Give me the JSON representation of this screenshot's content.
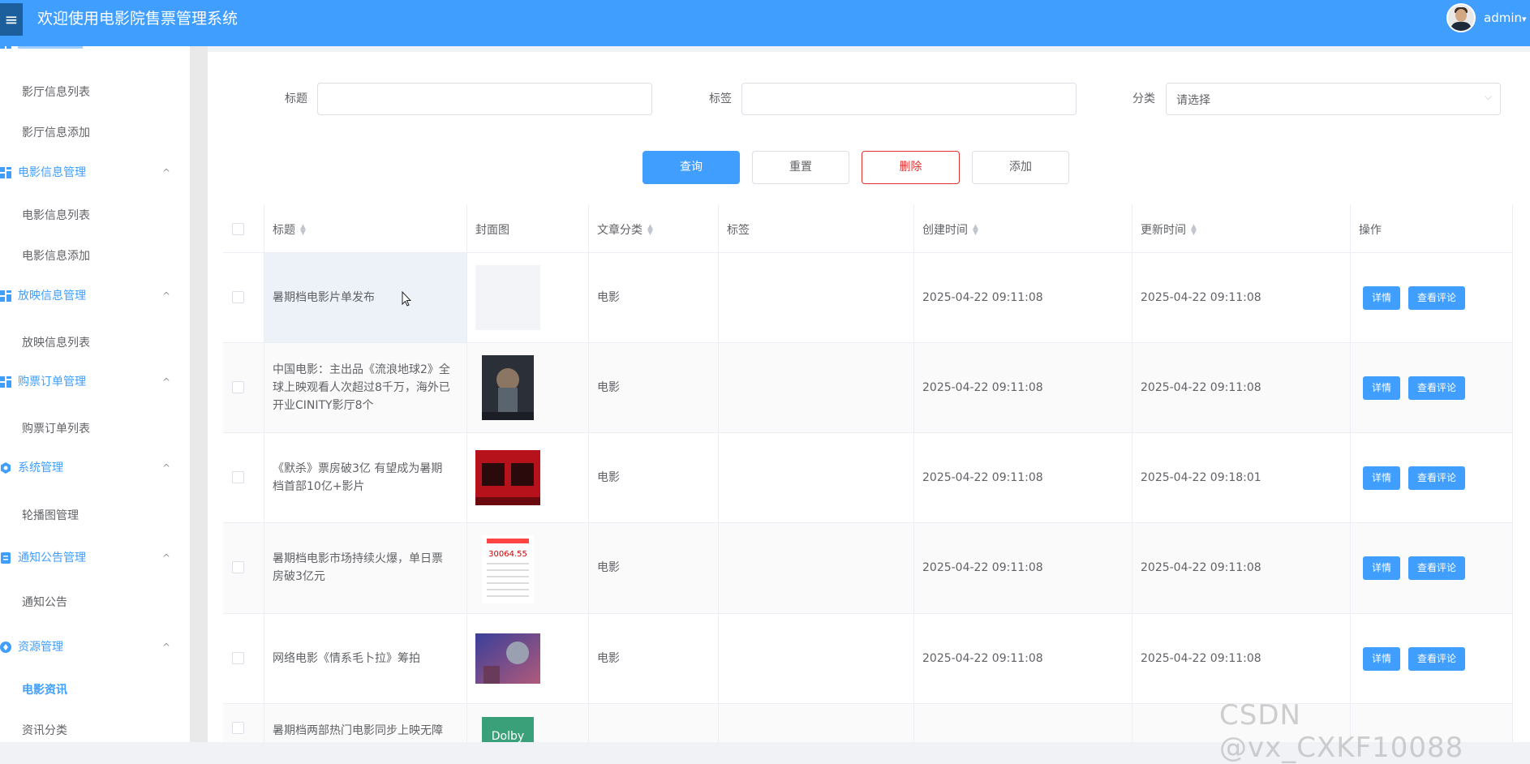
{
  "header": {
    "title": "欢迎使用电影院售票管理系统",
    "username": "admin",
    "dropdown_caret": "▾",
    "menu_toggle_glyph": "≡"
  },
  "sidebar": {
    "items": [
      {
        "type": "item",
        "label": "影厅信息列表"
      },
      {
        "type": "item",
        "label": "影厅信息添加"
      },
      {
        "type": "group",
        "label": "电影信息管理",
        "icon": "grid-icon"
      },
      {
        "type": "item",
        "label": "电影信息列表"
      },
      {
        "type": "item",
        "label": "电影信息添加"
      },
      {
        "type": "group",
        "label": "放映信息管理",
        "icon": "grid-icon"
      },
      {
        "type": "item",
        "label": "放映信息列表"
      },
      {
        "type": "group",
        "label": "购票订单管理",
        "icon": "grid-icon"
      },
      {
        "type": "item",
        "label": "购票订单列表"
      },
      {
        "type": "group",
        "label": "系统管理",
        "icon": "gear-icon"
      },
      {
        "type": "item",
        "label": "轮播图管理"
      },
      {
        "type": "group",
        "label": "通知公告管理",
        "icon": "document-icon"
      },
      {
        "type": "item",
        "label": "通知公告"
      },
      {
        "type": "group",
        "label": "资源管理",
        "icon": "resource-icon"
      },
      {
        "type": "item",
        "label": "电影资讯",
        "active": true
      },
      {
        "type": "item",
        "label": "资讯分类"
      }
    ],
    "chevron": "^"
  },
  "filters": {
    "title_label": "标题",
    "title_value": "",
    "tag_label": "标签",
    "tag_value": "",
    "category_label": "分类",
    "category_placeholder": "请选择"
  },
  "actions": {
    "query": "查询",
    "reset": "重置",
    "delete": "删除",
    "add": "添加"
  },
  "table": {
    "headers": {
      "title": "标题",
      "cover": "封面图",
      "category": "文章分类",
      "tags": "标签",
      "created": "创建时间",
      "updated": "更新时间",
      "ops": "操作"
    },
    "rows": [
      {
        "title": "暑期档电影片单发布",
        "category": "电影",
        "tags": "",
        "created": "2025-04-22 09:11:08",
        "updated": "2025-04-22 09:11:08",
        "cover": "blank"
      },
      {
        "title": "中国电影：主出品《流浪地球2》全球上映观看人次超过8千万，海外已开业CINITY影厅8个",
        "category": "电影",
        "tags": "",
        "created": "2025-04-22 09:11:08",
        "updated": "2025-04-22 09:11:08",
        "cover": "wandering-earth-poster"
      },
      {
        "title": "《默杀》票房破3亿 有望成为暑期档首部10亿+影片",
        "category": "电影",
        "tags": "",
        "created": "2025-04-22 09:11:08",
        "updated": "2025-04-22 09:18:01",
        "cover": "red-poster"
      },
      {
        "title": "暑期档电影市场持续火爆，单日票房破3亿元",
        "category": "电影",
        "tags": "",
        "created": "2025-04-22 09:11:08",
        "updated": "2025-04-22 09:11:08",
        "cover": "box-office-chart",
        "cover_text": "30064.55"
      },
      {
        "title": "网络电影《情系毛卜拉》筹拍",
        "category": "电影",
        "tags": "",
        "created": "2025-04-22 09:11:08",
        "updated": "2025-04-22 09:11:08",
        "cover": "purple-poster"
      },
      {
        "title": "暑期档两部热门电影同步上映无障碍",
        "category": "",
        "tags": "",
        "created": "",
        "updated": "",
        "cover": "dolby-poster",
        "cover_text": "Dolby"
      }
    ],
    "detail_label": "详情",
    "comments_label": "查看评论"
  },
  "watermark": "CSDN @vx_CXKF10088",
  "colors": {
    "primary": "#409eff",
    "danger": "#e23030",
    "header_bg": "#409eff",
    "sidebar_bg": "#ffffff"
  }
}
